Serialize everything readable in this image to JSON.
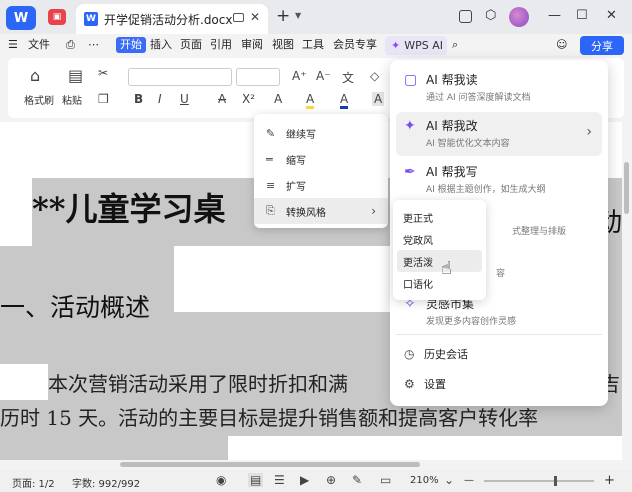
{
  "titlebar": {
    "logo": "W",
    "tab_name": "开学促销活动分析.docx",
    "tab_icon": "W",
    "close": "✕",
    "plus": "+"
  },
  "menubar": {
    "items": [
      "文件",
      "开始",
      "插入",
      "页面",
      "引用",
      "审阅",
      "视图",
      "工具",
      "会员专享"
    ],
    "wps_ai": "WPS AI",
    "share": "分享",
    "accent_color": "#3b6cf6"
  },
  "ribbon": {
    "format_painter": "格式刷",
    "paste": "粘贴",
    "bold": "B",
    "italic": "I",
    "underline": "U",
    "strike": "A",
    "superscript": "X²",
    "font_color": "A",
    "highlight": "A",
    "char_shade": "A",
    "char_border": "A"
  },
  "document": {
    "title": "**儿童学习桌",
    "title_right": "动",
    "heading": "一、活动概述",
    "para1": "本次营销活动采用了限时折扣和满",
    "para1_right": "吉",
    "para2": "历时 15 天。活动的主要目标是提升销售额和提高客户转化率"
  },
  "context_menu": {
    "items": [
      {
        "icon": "pen-icon",
        "label": "继续写"
      },
      {
        "icon": "lines-icon",
        "label": "缩写"
      },
      {
        "icon": "expand-icon",
        "label": "扩写"
      },
      {
        "icon": "style-icon",
        "label": "转换风格"
      }
    ]
  },
  "submenu": {
    "items": [
      "更正式",
      "党政风",
      "更活泼",
      "口语化"
    ]
  },
  "ai_panel": {
    "items": [
      {
        "title": "AI 帮我读",
        "desc": "通过 AI 问答深度解读文档"
      },
      {
        "title": "AI 帮我改",
        "desc": "AI 智能优化文本内容"
      },
      {
        "title": "AI 帮我写",
        "desc": "AI 根据主题创作，如生成大纲"
      },
      {
        "title": "",
        "desc": "式整理与排版"
      },
      {
        "title": "",
        "desc": "容"
      },
      {
        "title": "灵感市集",
        "desc": "发现更多内容创作灵感"
      }
    ],
    "history": "历史会话",
    "settings": "设置"
  },
  "statusbar": {
    "page": "页面: 1/2",
    "words": "字数: 992/992",
    "zoom": "210%",
    "minus": "—",
    "plus": "+"
  }
}
